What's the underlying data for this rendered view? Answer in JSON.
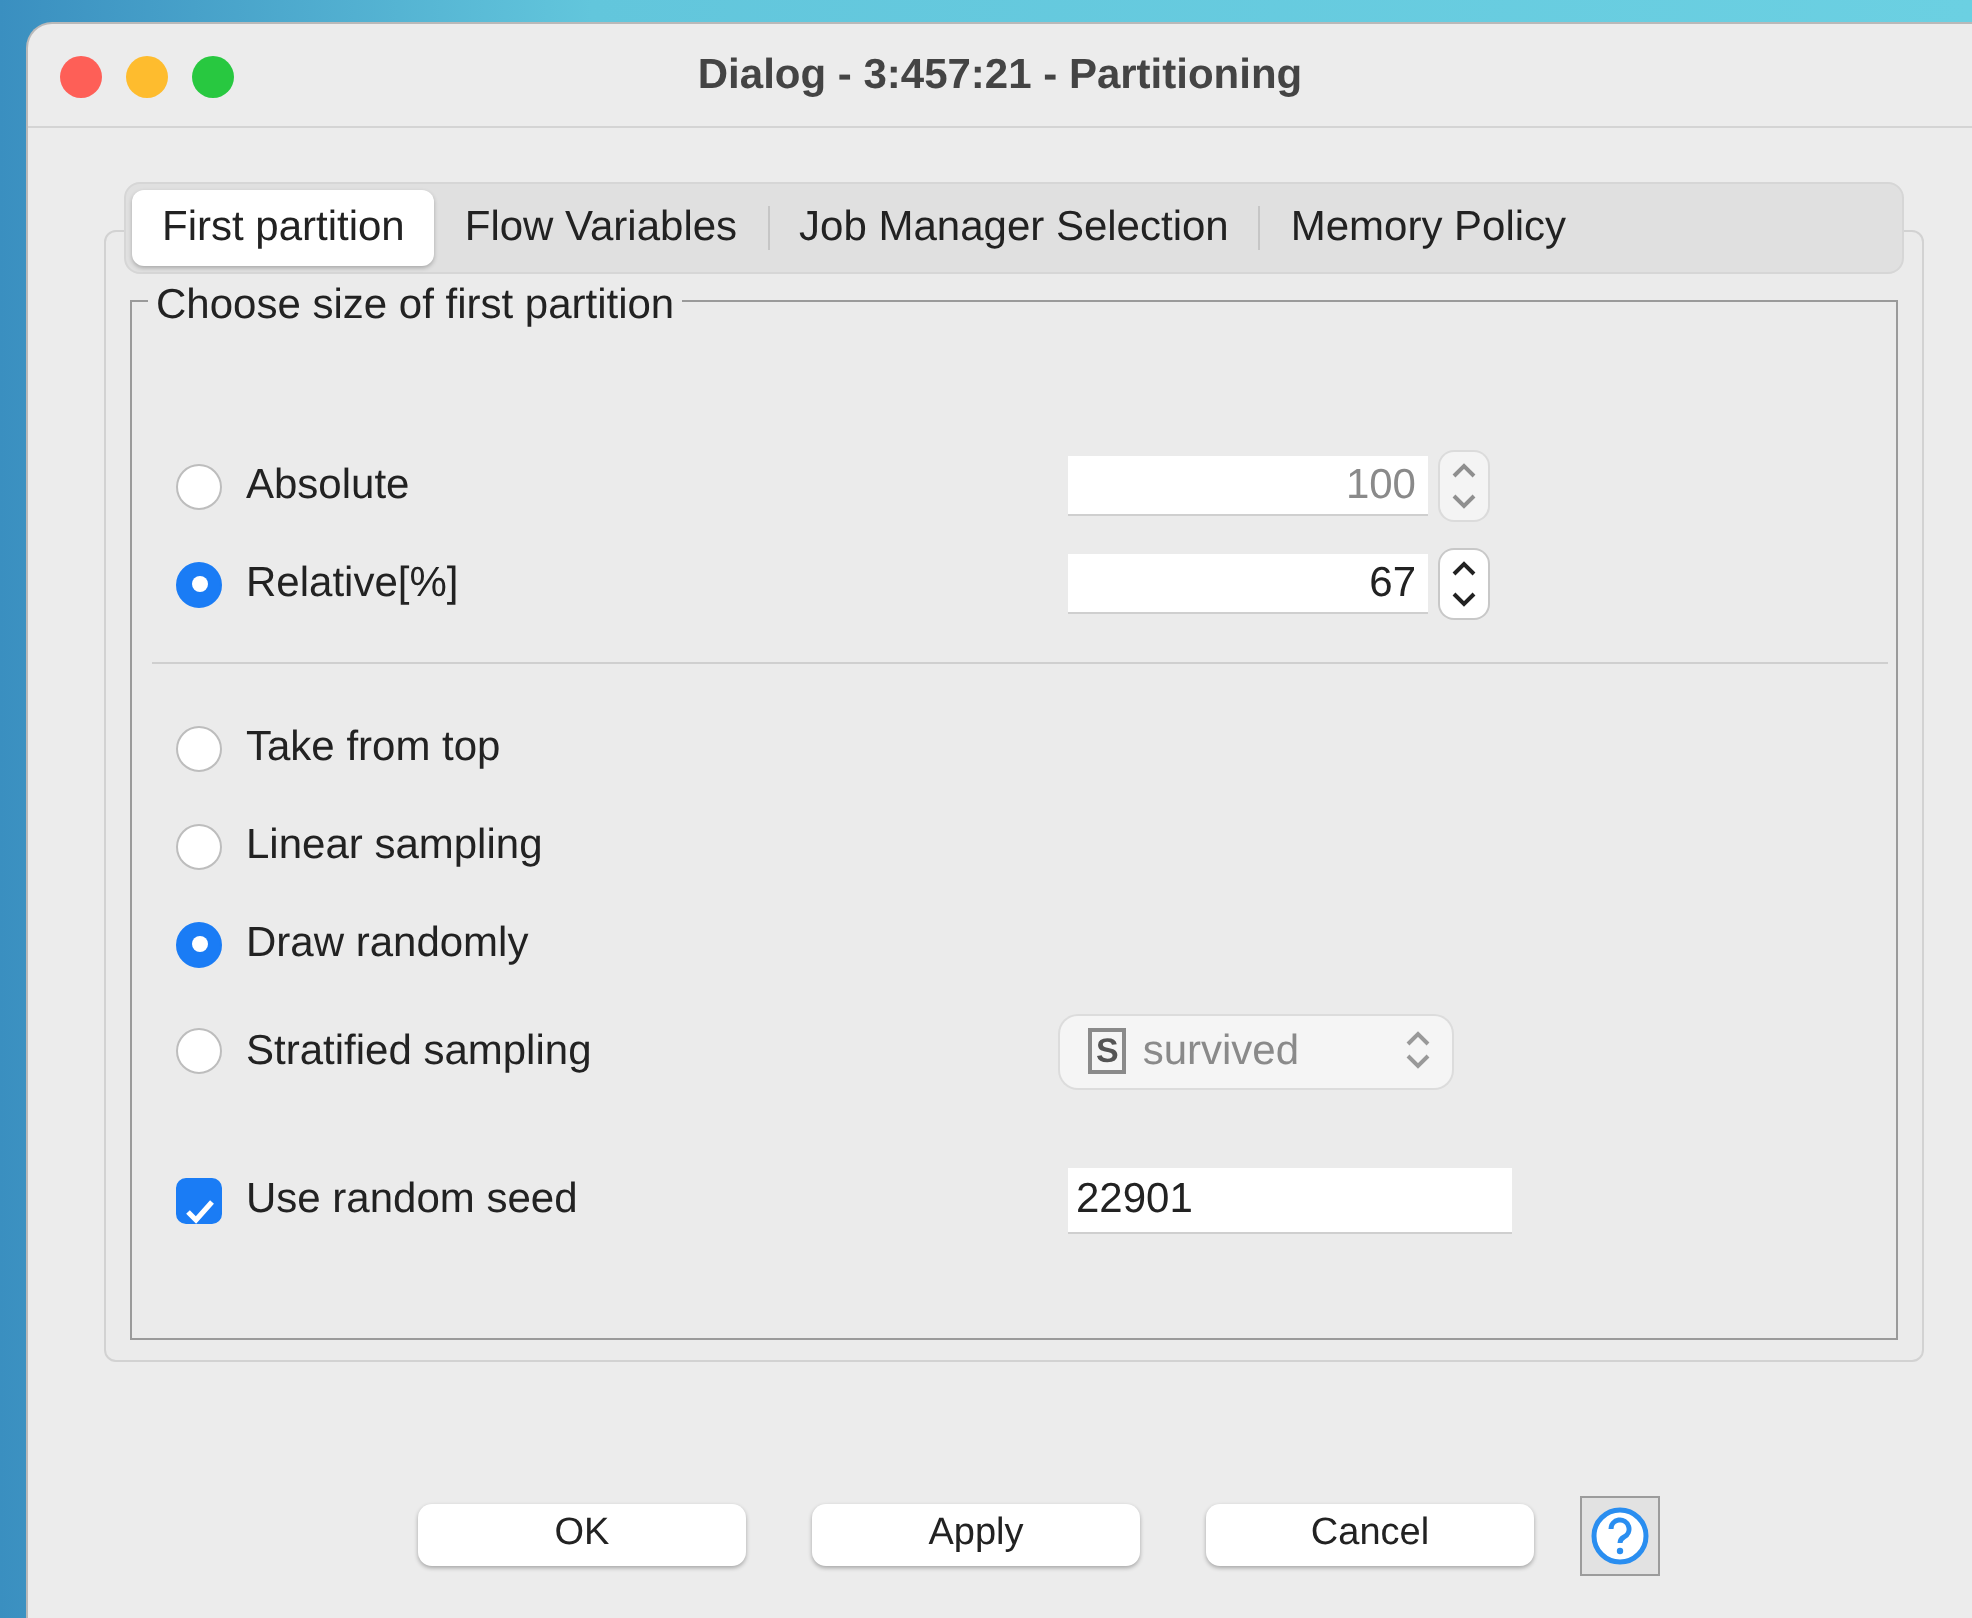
{
  "window": {
    "title": "Dialog - 3:457:21 - Partitioning"
  },
  "tabs": [
    {
      "label": "First partition",
      "selected": true
    },
    {
      "label": "Flow Variables",
      "selected": false
    },
    {
      "label": "Job Manager Selection",
      "selected": false
    },
    {
      "label": "Memory Policy",
      "selected": false
    }
  ],
  "group": {
    "title": "Choose size of first partition"
  },
  "size_options": [
    {
      "label": "Absolute",
      "selected": false,
      "value": "100",
      "disabled": true
    },
    {
      "label": "Relative[%]",
      "selected": true,
      "value": "67",
      "disabled": false
    }
  ],
  "sampling_options": [
    {
      "label": "Take from top",
      "selected": false
    },
    {
      "label": "Linear sampling",
      "selected": false
    },
    {
      "label": "Draw randomly",
      "selected": true
    },
    {
      "label": "Stratified sampling",
      "selected": false,
      "column": {
        "type_icon": "S",
        "value": "survived",
        "disabled": true
      }
    }
  ],
  "random_seed": {
    "label": "Use random seed",
    "checked": true,
    "value": "22901"
  },
  "buttons": [
    "OK",
    "Apply",
    "Cancel"
  ]
}
